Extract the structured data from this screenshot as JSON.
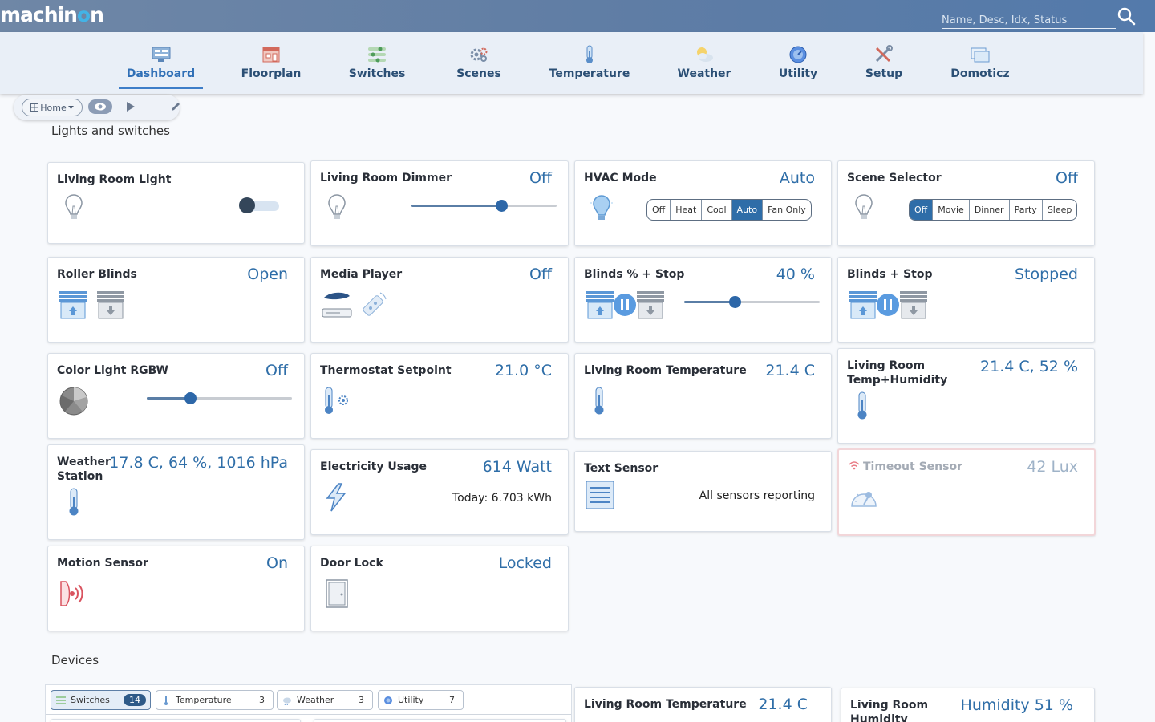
{
  "app": {
    "logo_a": "machin",
    "logo_o": "o",
    "logo_b": "n"
  },
  "search": {
    "placeholder": "Name, Desc, Idx, Status"
  },
  "nav": [
    {
      "label": "Dashboard",
      "icon": "dashboard-icon"
    },
    {
      "label": "Floorplan",
      "icon": "floorplan-icon"
    },
    {
      "label": "Switches",
      "icon": "switches-icon"
    },
    {
      "label": "Scenes",
      "icon": "scenes-icon"
    },
    {
      "label": "Temperature",
      "icon": "thermometer-icon"
    },
    {
      "label": "Weather",
      "icon": "weather-icon"
    },
    {
      "label": "Utility",
      "icon": "utility-icon"
    },
    {
      "label": "Setup",
      "icon": "setup-icon"
    },
    {
      "label": "Domoticz",
      "icon": "domoticz-icon"
    }
  ],
  "toolbar": {
    "home_label": "Home",
    "home_icon": "grid-icon",
    "view_icon": "eye-icon",
    "play_icon": "play-icon",
    "edit_icon": "pencil-icon"
  },
  "sections": {
    "lights": "Lights and switches",
    "devices": "Devices"
  },
  "cards": {
    "living_room_light": {
      "title": "Living Room Light",
      "state": "off"
    },
    "living_room_dimmer": {
      "title": "Living Room Dimmer",
      "status": "Off",
      "level": 0.62
    },
    "hvac_mode": {
      "title": "HVAC Mode",
      "status": "Auto",
      "options": [
        "Off",
        "Heat",
        "Cool",
        "Auto",
        "Fan Only"
      ],
      "selected": "Auto"
    },
    "scene_selector": {
      "title": "Scene Selector",
      "status": "Off",
      "options": [
        "Off",
        "Movie",
        "Dinner",
        "Party",
        "Sleep"
      ],
      "selected": "Off"
    },
    "roller_blinds": {
      "title": "Roller Blinds",
      "status": "Open"
    },
    "media_player": {
      "title": "Media Player",
      "status": "Off"
    },
    "blinds_pct_stop": {
      "title": "Blinds % + Stop",
      "status": "40 %",
      "level": 0.37
    },
    "blinds_stop": {
      "title": "Blinds + Stop",
      "status": "Stopped"
    },
    "color_light": {
      "title": "Color Light RGBW",
      "status": "Off",
      "level": 0.3
    },
    "thermostat": {
      "title": "Thermostat Setpoint",
      "status": "21.0 °C"
    },
    "living_room_temp": {
      "title": "Living Room Temperature",
      "status": "21.4 C"
    },
    "living_room_temp_hum": {
      "title_1": "Living Room",
      "title_2": "Temp+Humidity",
      "status": "21.4 C, 52 %"
    },
    "weather_station": {
      "title_1": "Weather",
      "title_2": "Station",
      "status": "17.8 C, 64 %, 1016 hPa"
    },
    "electricity": {
      "title": "Electricity Usage",
      "status": "614 Watt",
      "today": "Today: 6.703 kWh"
    },
    "text_sensor": {
      "title": "Text Sensor",
      "text": "All sensors reporting"
    },
    "timeout_sensor": {
      "title": "Timeout Sensor",
      "status": "42 Lux"
    },
    "motion_sensor": {
      "title": "Motion Sensor",
      "status": "On"
    },
    "door_lock": {
      "title": "Door Lock",
      "status": "Locked"
    }
  },
  "device_tabs": [
    {
      "label": "Switches",
      "count": "14"
    },
    {
      "label": "Temperature",
      "count": "3"
    },
    {
      "label": "Weather",
      "count": "3"
    },
    {
      "label": "Utility",
      "count": "7"
    }
  ],
  "bottom_cards": {
    "temp": {
      "title": "Living Room Temperature",
      "status": "21.4 C"
    },
    "humidity": {
      "title_1": "Living Room",
      "title_2": "Humidity",
      "status": "Humidity 51 %"
    }
  },
  "colors": {
    "accent": "#2f6ea8",
    "nav_text": "#2b4f75",
    "topbar": "#5f7da5"
  }
}
